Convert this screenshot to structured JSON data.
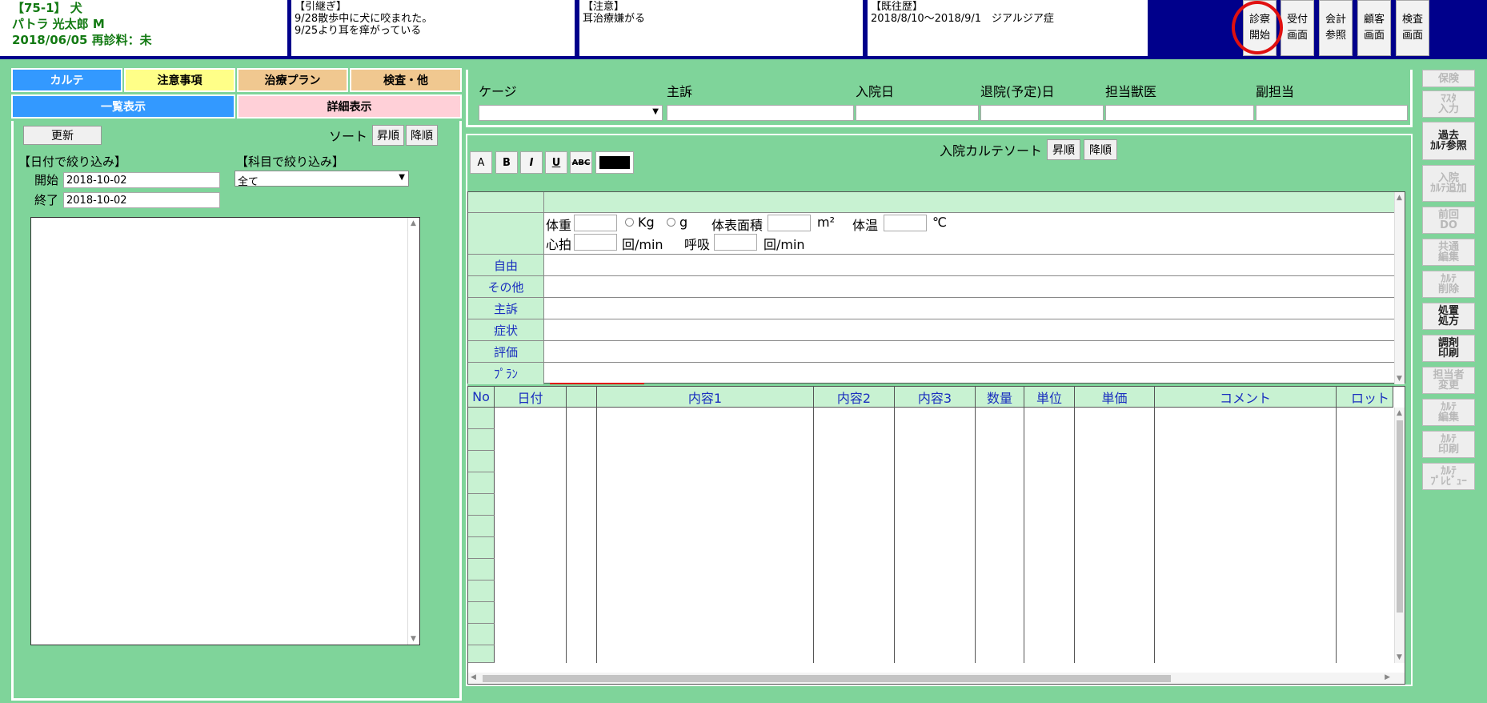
{
  "header": {
    "patient": {
      "line1": "【75-1】 犬",
      "line2": "パトラ 光太郎 M",
      "line3": "2018/06/05 再診料：未"
    },
    "handover": {
      "title": "【引継ぎ】",
      "line1": "9/28散歩中に犬に咬まれた。",
      "line2": "9/25より耳を痒がっている"
    },
    "caution": {
      "title": "【注意】",
      "line1": "耳治療嫌がる"
    },
    "history": {
      "title": "【既往歴】",
      "line1": "2018/8/10～2018/9/1　ジアルジア症"
    },
    "buttons": [
      {
        "l1": "診察",
        "l2": "開始"
      },
      {
        "l1": "受付",
        "l2": "画面"
      },
      {
        "l1": "会計",
        "l2": "参照"
      },
      {
        "l1": "顧客",
        "l2": "画面"
      },
      {
        "l1": "検査",
        "l2": "画面"
      }
    ]
  },
  "left": {
    "tabs": [
      "カルテ",
      "注意事項",
      "治療プラン",
      "検査・他"
    ],
    "subtabs": [
      "一覧表示",
      "詳細表示"
    ],
    "refresh": "更新",
    "sort_label": "ソート",
    "asc": "昇順",
    "desc": "降順",
    "date_filter": "【日付で絞り込み】",
    "subject_filter": "【科目で絞り込み】",
    "start_label": "開始",
    "end_label": "終了",
    "start_value": "2018-10-02",
    "end_value": "2018-10-02",
    "subject_value": "全て"
  },
  "admission": {
    "labels": [
      "ケージ",
      "主訴",
      "入院日",
      "退院(予定)日",
      "担当獣医",
      "副担当"
    ]
  },
  "editor": {
    "sort_label": "入院カルテソート",
    "asc": "昇順",
    "desc": "降順",
    "tools": [
      "A",
      "B",
      "I",
      "U",
      "ABC"
    ],
    "vitals": {
      "weight": "体重",
      "kg": "Kg",
      "g": "g",
      "bsa": "体表面積",
      "m2": "m²",
      "temp": "体温",
      "celsius": "℃",
      "hr": "心拍",
      "per_min": "回/min",
      "resp": "呼吸",
      "per_min2": "回/min"
    },
    "rows": [
      "自由",
      "その他",
      "主訴",
      "症状",
      "評価",
      "ﾌﾟﾗﾝ"
    ]
  },
  "grid": {
    "headers": [
      "No",
      "日付",
      "",
      "内容1",
      "内容2",
      "内容3",
      "数量",
      "単位",
      "単価",
      "コメント",
      "ロット"
    ]
  },
  "sidebar": [
    {
      "l1": "保険",
      "l2": "",
      "state": "disabled"
    },
    {
      "l1": "ﾏｽﾀ",
      "l2": "入力",
      "state": "disabled"
    },
    {
      "l1": "過去",
      "l2": "ｶﾙﾃ参照",
      "state": "enabled"
    },
    {
      "l1": "入院",
      "l2": "ｶﾙﾃ追加",
      "state": "disabled"
    },
    {
      "l1": "前回",
      "l2": "DO",
      "state": "disabled"
    },
    {
      "l1": "共通",
      "l2": "編集",
      "state": "disabled"
    },
    {
      "l1": "ｶﾙﾃ",
      "l2": "削除",
      "state": "disabled"
    },
    {
      "l1": "処置",
      "l2": "処方",
      "state": "enabled"
    },
    {
      "l1": "調剤",
      "l2": "印刷",
      "state": "enabled"
    },
    {
      "l1": "担当者",
      "l2": "変更",
      "state": "disabled"
    },
    {
      "l1": "ｶﾙﾃ",
      "l2": "編集",
      "state": "disabled"
    },
    {
      "l1": "ｶﾙﾃ",
      "l2": "印刷",
      "state": "disabled"
    },
    {
      "l1": "ｶﾙﾃ",
      "l2": "ﾌﾟﾚﾋﾞｭｰ",
      "state": "disabled"
    }
  ],
  "colors": {
    "header_bg": "#00008b",
    "page_bg": "#7fd49a",
    "tab_blue": "#3399ff",
    "tab_yellow": "#ffff88",
    "tab_tan": "#f0c890",
    "subtab_pink": "#ffd0d8",
    "highlight_red": "#e01010"
  }
}
